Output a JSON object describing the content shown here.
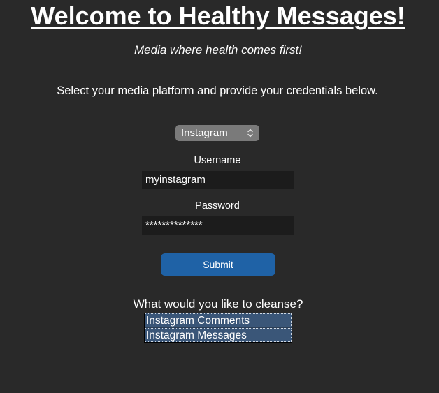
{
  "header": {
    "title": "Welcome to Healthy Messages!",
    "subtitle": "Media where health comes first!",
    "instructions": "Select your media platform and provide your credentials below."
  },
  "platform_select": {
    "selected": "Instagram"
  },
  "credentials": {
    "username_label": "Username",
    "username_value": "myinstagram",
    "password_label": "Password",
    "password_value": "**************"
  },
  "submit_label": "Submit",
  "cleanse": {
    "label": "What would you like to cleanse?",
    "options": [
      "Instagram Comments",
      "Instagram Messages"
    ]
  }
}
